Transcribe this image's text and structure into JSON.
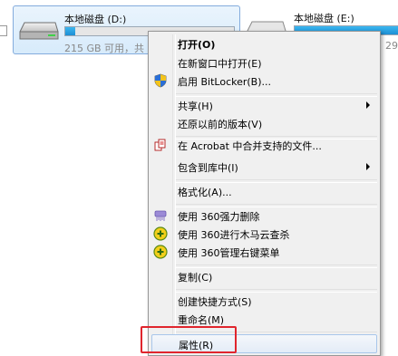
{
  "drives": [
    {
      "name": "本地磁盘 (D:)",
      "free_text": "215 GB 可用，共",
      "usage": 0.06
    },
    {
      "name": "本地磁盘 (E:)",
      "free_text": "29",
      "usage": 0.99
    }
  ],
  "menu": {
    "items": {
      "open": "打开(O)",
      "open_new_window": "在新窗口中打开(E)",
      "bitlocker": "启用 BitLocker(B)...",
      "share": "共享(H)",
      "restore_versions": "还原以前的版本(V)",
      "acrobat": "在 Acrobat 中合并支持的文件...",
      "include_library": "包含到库中(I)",
      "format": "格式化(A)...",
      "shred_360": "使用 360强力删除",
      "trojan_360": "使用 360进行木马云查杀",
      "menu_360": "使用 360管理右键菜单",
      "copy": "复制(C)",
      "create_shortcut": "创建快捷方式(S)",
      "rename": "重命名(M)",
      "properties": "属性(R)"
    }
  },
  "colors": {
    "highlight_border": "#e0252d",
    "usage_bar": "#1d8fd4"
  },
  "icons": {
    "bitlocker": "shield-icon",
    "acrobat": "acrobat-icon",
    "shred_360": "shredder-icon",
    "trojan_360": "360-icon",
    "menu_360": "360-icon"
  }
}
